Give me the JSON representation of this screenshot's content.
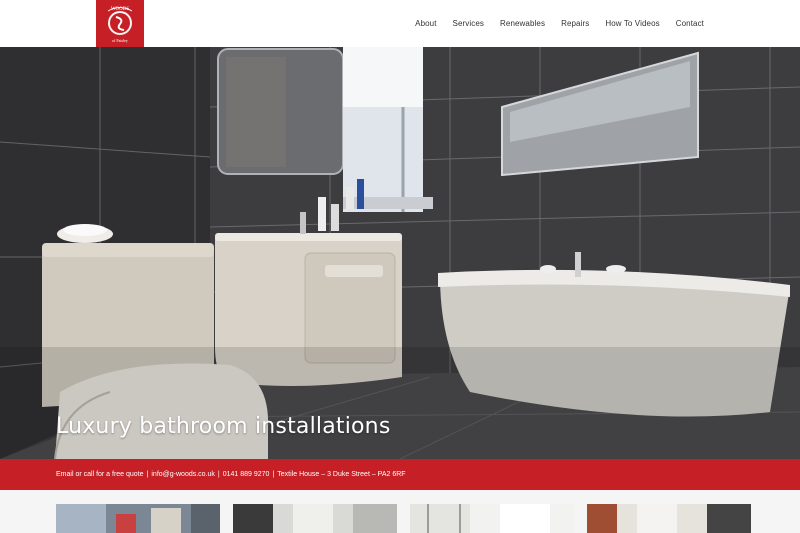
{
  "brand": {
    "logo_text_top": "WOODS",
    "logo_text_bottom": "of Paisley"
  },
  "nav": {
    "items": [
      {
        "label": "About"
      },
      {
        "label": "Services"
      },
      {
        "label": "Renewables"
      },
      {
        "label": "Repairs"
      },
      {
        "label": "How To Videos"
      },
      {
        "label": "Contact"
      }
    ]
  },
  "hero": {
    "title": "Luxury bathroom installations"
  },
  "infobar": {
    "lead": "Email or call for a free quote",
    "email": "info@g-woods.co.uk",
    "phone": "0141 889 9270",
    "address": "Textile House – 3 Duke Street – PA2 6RF",
    "separator": "|"
  },
  "colors": {
    "brand_red": "#c61f26",
    "header_bg": "#ffffff",
    "tile_dark": "#3a3a3c"
  },
  "thumbnails": [
    {
      "icon": "kitchen-thumbnail"
    },
    {
      "icon": "bathroom-thumbnail"
    },
    {
      "icon": "shower-thumbnail"
    },
    {
      "icon": "room-thumbnail"
    }
  ]
}
